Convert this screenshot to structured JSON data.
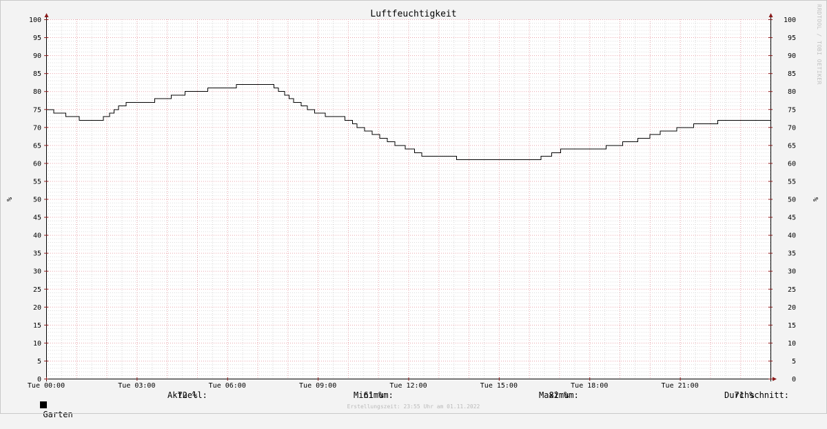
{
  "chart_data": {
    "type": "line",
    "title": "Luftfeuchtigkeit",
    "ylabel": "%",
    "ylabel_right": "%",
    "ylim": [
      0,
      100
    ],
    "y_ticks": [
      0,
      5,
      10,
      15,
      20,
      25,
      30,
      35,
      40,
      45,
      50,
      55,
      60,
      65,
      70,
      75,
      80,
      85,
      90,
      95,
      100
    ],
    "x_range_hours": [
      0,
      24
    ],
    "x_ticks": [
      {
        "h": 0,
        "label": "Tue 00:00"
      },
      {
        "h": 3,
        "label": "Tue 03:00"
      },
      {
        "h": 6,
        "label": "Tue 06:00"
      },
      {
        "h": 9,
        "label": "Tue 09:00"
      },
      {
        "h": 12,
        "label": "Tue 12:00"
      },
      {
        "h": 15,
        "label": "Tue 15:00"
      },
      {
        "h": 18,
        "label": "Tue 18:00"
      },
      {
        "h": 21,
        "label": "Tue 21:00"
      }
    ],
    "grid": true,
    "series": [
      {
        "name": "Garten",
        "color": "#000000",
        "points": [
          [
            0.0,
            75
          ],
          [
            0.25,
            74
          ],
          [
            0.65,
            73
          ],
          [
            1.1,
            72
          ],
          [
            1.9,
            73
          ],
          [
            2.1,
            74
          ],
          [
            2.25,
            75
          ],
          [
            2.4,
            76
          ],
          [
            2.65,
            77
          ],
          [
            3.6,
            78
          ],
          [
            4.15,
            79
          ],
          [
            4.6,
            80
          ],
          [
            5.35,
            81
          ],
          [
            6.3,
            82
          ],
          [
            7.55,
            81
          ],
          [
            7.7,
            80
          ],
          [
            7.9,
            79
          ],
          [
            8.05,
            78
          ],
          [
            8.2,
            77
          ],
          [
            8.45,
            76
          ],
          [
            8.65,
            75
          ],
          [
            8.9,
            74
          ],
          [
            9.25,
            73
          ],
          [
            9.9,
            72
          ],
          [
            10.15,
            71
          ],
          [
            10.3,
            70
          ],
          [
            10.55,
            69
          ],
          [
            10.8,
            68
          ],
          [
            11.05,
            67
          ],
          [
            11.3,
            66
          ],
          [
            11.55,
            65
          ],
          [
            11.9,
            64
          ],
          [
            12.2,
            63
          ],
          [
            12.45,
            62
          ],
          [
            13.6,
            61
          ],
          [
            16.4,
            62
          ],
          [
            16.75,
            63
          ],
          [
            17.05,
            64
          ],
          [
            18.55,
            65
          ],
          [
            19.1,
            66
          ],
          [
            19.6,
            67
          ],
          [
            20.0,
            68
          ],
          [
            20.35,
            69
          ],
          [
            20.9,
            70
          ],
          [
            21.45,
            71
          ],
          [
            22.25,
            72
          ],
          [
            24.0,
            72
          ]
        ]
      }
    ]
  },
  "legend": {
    "series_name": "Garten",
    "aktuell_label": "Aktuell:",
    "aktuell_value": "72 %",
    "minimum_label": "Minimum:",
    "minimum_value": "61 %",
    "maximum_label": "Maximum:",
    "maximum_value": "82 %",
    "durchschnitt_label": "Durchschnitt:",
    "durchschnitt_value": "71 %"
  },
  "footer": "Erstellungszeit: 23:55 Uhr am 01.11.2022",
  "side_credit": "RRDTOOL / TOBI OETIKER",
  "colors": {
    "background": "#f3f3f3",
    "plot_bg": "#ffffff",
    "grid_minor": "#d9d9d9",
    "grid_major": "#e8a0a8",
    "axis": "#000000",
    "arrow": "#8b1a1a",
    "line": "#000000"
  }
}
